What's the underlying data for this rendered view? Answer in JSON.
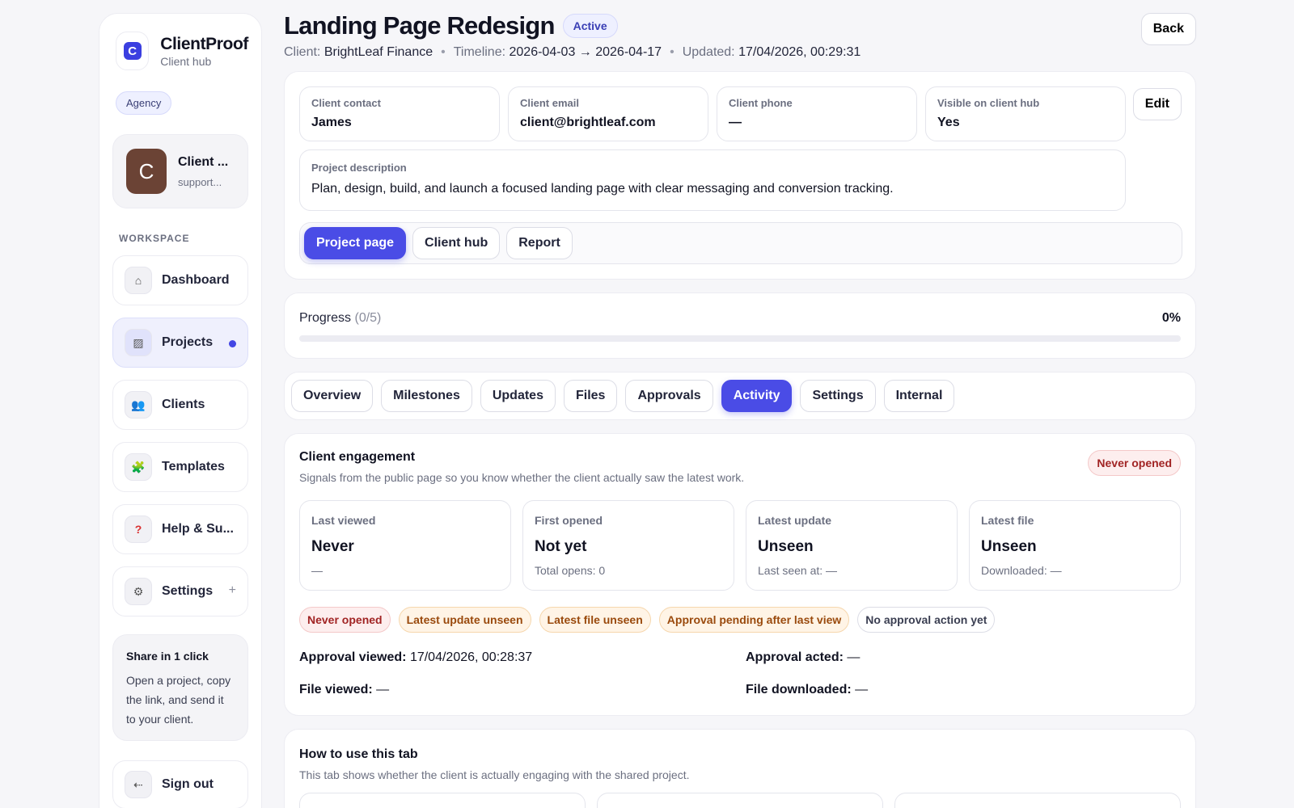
{
  "brand": {
    "name": "ClientProof",
    "subtitle": "Client hub",
    "logo_letter": "C"
  },
  "sidebar": {
    "agency_badge": "Agency",
    "user": {
      "initial": "C",
      "name": "Client ...",
      "email": "support..."
    },
    "section_label": "WORKSPACE",
    "items": [
      {
        "label": "Dashboard",
        "icon": "⌂"
      },
      {
        "label": "Projects",
        "icon": "▨"
      },
      {
        "label": "Clients",
        "icon": "👥"
      },
      {
        "label": "Templates",
        "icon": "🧩"
      },
      {
        "label": "Help & Su...",
        "icon": "?"
      },
      {
        "label": "Settings",
        "icon": "⚙"
      }
    ],
    "settings_plus": "+",
    "share": {
      "title": "Share in 1 click",
      "text": "Open a project, copy the link, and send it to your client."
    },
    "signout": {
      "label": "Sign out",
      "icon": "⇠"
    }
  },
  "header": {
    "title": "Landing Page Redesign",
    "status": "Active",
    "back_label": "Back",
    "client_label": "Client:",
    "client_value": "BrightLeaf Finance",
    "timeline_label": "Timeline:",
    "timeline_value": "2026-04-03 → 2026-04-17",
    "updated_label": "Updated:",
    "updated_value": "17/04/2026, 00:29:31",
    "sep": "•"
  },
  "info": {
    "fields": [
      {
        "label": "Client contact",
        "value": "James"
      },
      {
        "label": "Client email",
        "value": "client@brightleaf.com"
      },
      {
        "label": "Client phone",
        "value": "—"
      },
      {
        "label": "Visible on client hub",
        "value": "Yes"
      }
    ],
    "edit_label": "Edit",
    "description_label": "Project description",
    "description_value": "Plan, design, build, and launch a focused landing page with clear messaging and conversion tracking.",
    "view_tabs": [
      "Project page",
      "Client hub",
      "Report"
    ]
  },
  "progress": {
    "label": "Progress",
    "count": "(0/5)",
    "percent": "0%",
    "value": 0
  },
  "tabs": [
    "Overview",
    "Milestones",
    "Updates",
    "Files",
    "Approvals",
    "Activity",
    "Settings",
    "Internal"
  ],
  "engagement": {
    "title": "Client engagement",
    "subtitle": "Signals from the public page so you know whether the client actually saw the latest work.",
    "badge": "Never opened",
    "stats": [
      {
        "label": "Last viewed",
        "value": "Never",
        "foot": "—"
      },
      {
        "label": "First opened",
        "value": "Not yet",
        "foot": "Total opens: 0"
      },
      {
        "label": "Latest update",
        "value": "Unseen",
        "foot": "Last seen at: —"
      },
      {
        "label": "Latest file",
        "value": "Unseen",
        "foot": "Downloaded: —"
      }
    ],
    "chips": [
      "Never opened",
      "Latest update unseen",
      "Latest file unseen",
      "Approval pending after last view",
      "No approval action yet"
    ],
    "details": {
      "approval_viewed_label": "Approval viewed:",
      "approval_viewed_value": "17/04/2026, 00:28:37",
      "approval_acted_label": "Approval acted:",
      "approval_acted_value": "—",
      "file_viewed_label": "File viewed:",
      "file_viewed_value": "—",
      "file_downloaded_label": "File downloaded:",
      "file_downloaded_value": "—"
    }
  },
  "howto": {
    "title": "How to use this tab",
    "subtitle": "This tab shows whether the client is actually engaging with the shared project."
  }
}
